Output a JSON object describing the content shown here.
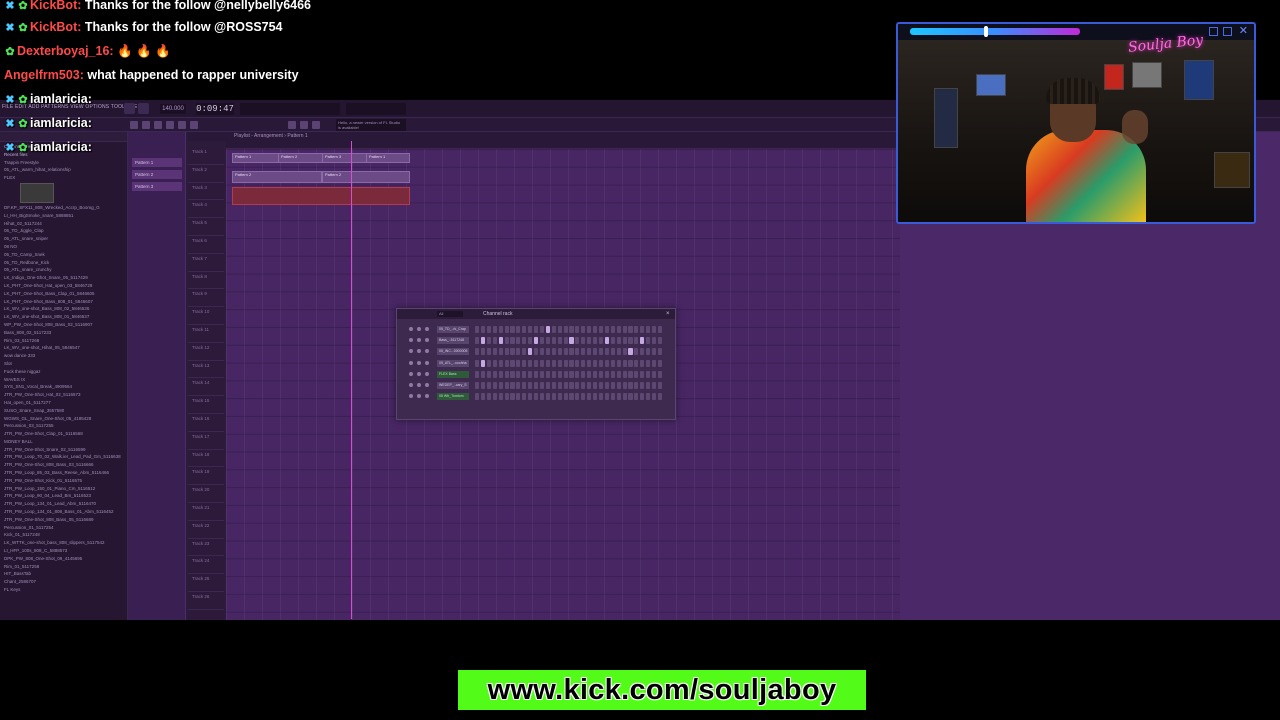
{
  "chat": [
    {
      "user": "KickBot",
      "color": "#ff4a4a",
      "badges": [
        "x-icon",
        "bot-icon"
      ],
      "message": "Thanks for the follow @nellybelly6466"
    },
    {
      "user": "KickBot",
      "color": "#ff4a4a",
      "badges": [
        "x-icon",
        "bot-icon"
      ],
      "message": "Thanks for the follow @ROSS754"
    },
    {
      "user": "Dexterboyaj_16",
      "color": "#ff4a4a",
      "badges": [
        "gift-icon"
      ],
      "message": "🔥 🔥 🔥"
    },
    {
      "user": "Angelfrm503",
      "color": "#ff4a4a",
      "badges": [],
      "message": "what happened to rapper university"
    },
    {
      "user": "iamlaricia",
      "color": "#ffffff",
      "badges": [
        "x-icon",
        "bot-icon"
      ],
      "message": ""
    },
    {
      "user": "iamlaricia",
      "color": "#ffffff",
      "badges": [
        "x-icon",
        "bot-icon"
      ],
      "message": ""
    },
    {
      "user": "iamlaricia",
      "color": "#ffffff",
      "badges": [
        "x-icon",
        "bot-icon"
      ],
      "message": ""
    }
  ],
  "daw": {
    "menu": "FILE EDIT ADD PATTERNS VIEW OPTIONS TOOLS HELP",
    "time": "0:09:47",
    "tempo": "140.000",
    "hint": "Hello, a newer version of FL Studio is available!",
    "playlist_title": "Playlist - Arrangement › Pattern 1",
    "browser_items": [
      "Current project",
      "Recent files",
      "Trappin Freestyle",
      "05_ATL_warm_hihat_relationship",
      "FLEX",
      "DF.KP_SFX11_808_Wrecked_Accrp_Boomg_G",
      "LI_HH_BigSmoke_snare_5888851",
      "Hihat_02_5117244",
      "05_TD_Jiggle_Clap",
      "05_ATL_snare_sniper",
      "08 NO",
      "05_TD_Camp_Snek",
      "05_TD_Redbone_Kick",
      "05_ATL_snare_crunchy",
      "LK_Indigo_One-Shot_Snare_05_5117429",
      "LK_PHT_One-Shot_Hat_open_03_5846728",
      "LK_PHT_One-Shot_Bass_Clap_01_5846605",
      "LK_PHT_One-Shot_Bass_808_01_5846607",
      "LK_WV_one-shot_Bass_808_02_5846536",
      "LK_WV_one-shot_Bass_808_01_5846537",
      "WP_PW_One-Shot_808_Bass_02_5116907",
      "Bass_808_02_5117233",
      "Rim_03_5117268",
      "LK_WV_one-shot_Hihat_05_5846547",
      "wow dance 333",
      "Slot",
      "Fuck these niggaz",
      "WAVES IX",
      "SYS_SN1_Vocal_Break_4909564",
      "JTR_PW_One-Shot_Hat_02_5116573",
      "Hat_open_01_5117277",
      "SUSO_Snare_Snap_3557580",
      "WGWS_GL_Snare_One-Shot_05_4185428",
      "Percussion_03_5117255",
      "JTR_PW_One-Shot_Clap_01_5116568",
      "MONEY BALL",
      "JTR_PW_One-Shot_Snare_02_5116599",
      "JTR_PW_Loop_70_02_Walk.ier_Lead_Pad_Gm_5116638",
      "JTR_PW_One-Shot_808_Bass_03_5116666",
      "JTR_PW_Loop_85_03_Bass_Reese_Abm_5116466",
      "JTR_PW_One-Shot_Kick_01_5116575",
      "JTR_PW_Loop_150_01_Piano_Cm_5116512",
      "JTR_PW_Loop_90_04_Lead_Bm_5116523",
      "JTR_PW_Loop_134_01_Lead_Abm_5116470",
      "JTR_PW_Loop_134_01_808_Bass_01_Abm_5116452",
      "JTR_PW_One-Shot_808_Bass_05_5116689",
      "Percussion_01_5117254",
      "Kick_01_5117248",
      "LK_WTTK_one-shot_bass_808_slippers_5117542",
      "LI_HFP_100s_808_C_5888573",
      "DPK_PW_808_One-Shot_09_4145695",
      "Rim_01_5117258",
      "HIT_BassTab",
      "Chant_2586707",
      "FL Keys"
    ],
    "patterns": [
      "Pattern 1",
      "Pattern 2",
      "Pattern 3"
    ],
    "tracks": [
      "Track 1",
      "Track 2",
      "Track 3",
      "Track 4",
      "Track 5",
      "Track 6",
      "Track 7",
      "Track 8",
      "Track 9",
      "Track 10",
      "Track 11",
      "Track 12",
      "Track 13",
      "Track 14",
      "Track 15",
      "Track 16",
      "Track 17",
      "Track 18",
      "Track 19",
      "Track 20",
      "Track 21",
      "Track 22",
      "Track 23",
      "Track 24",
      "Track 25",
      "Track 26"
    ],
    "clip_label": "Pattern 1",
    "channel_rack": {
      "title": "Channel rack",
      "filter": "All",
      "channels": [
        {
          "name": "05_TD_..rk_Crap",
          "highlight": false
        },
        {
          "name": "Bass_..5117248",
          "highlight": false
        },
        {
          "name": "05_INC...0000005",
          "highlight": false
        },
        {
          "name": "05_ATL_..ooohha",
          "highlight": false
        },
        {
          "name": "FLEX Bass",
          "highlight": true
        },
        {
          "name": "WEDEP_..cary_S",
          "highlight": false
        },
        {
          "name": "08 Wfr_Tomtom",
          "highlight": true
        }
      ]
    }
  },
  "webcam": {
    "signature": "Soulja Boy"
  },
  "footer": {
    "url": "www.kick.com/souljaboy"
  },
  "colors": {
    "kick_green": "#53fc18",
    "daw_purple": "#472663",
    "webcam_border": "#3a5bd9"
  }
}
